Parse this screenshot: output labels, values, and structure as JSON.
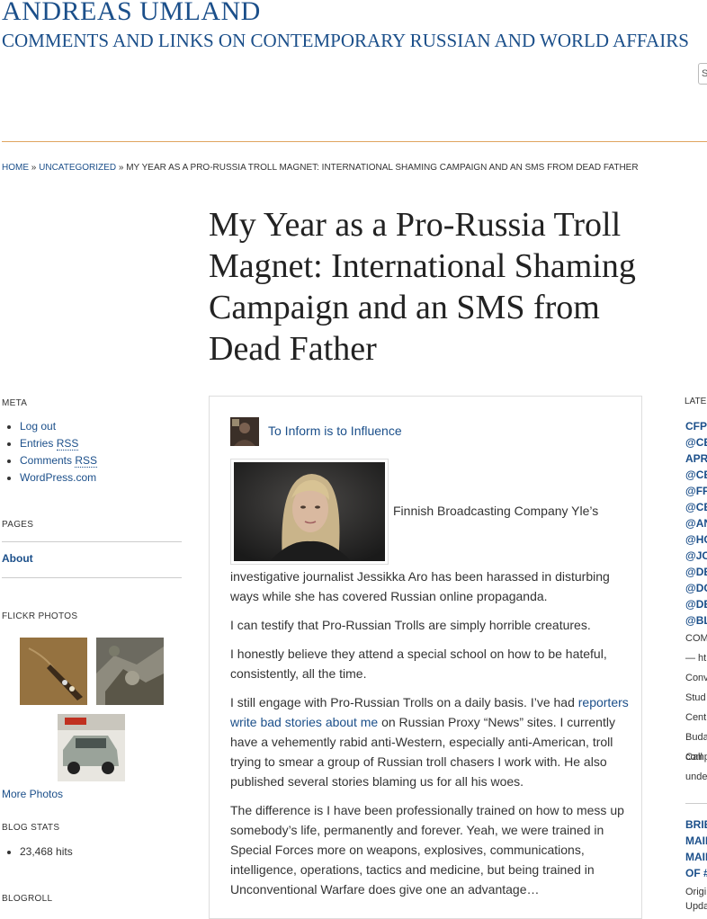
{
  "site": {
    "title": "ANDREAS UMLAND",
    "description": "COMMENTS AND LINKS ON CONTEMPORARY RUSSIAN AND WORLD AFFAIRS",
    "search_placeholder": "S"
  },
  "breadcrumb": {
    "home": "HOME",
    "sep1": " » ",
    "category": "UNCATEGORIZED",
    "sep2": " » ",
    "current": "MY YEAR AS A PRO-RUSSIA TROLL MAGNET: INTERNATIONAL SHAMING CAMPAIGN AND AN SMS FROM DEAD FATHER"
  },
  "post": {
    "title": "My Year as a Pro-Russia Troll Magnet: International Shaming Campaign and an SMS from Dead Father",
    "author": "To Inform is to Influence",
    "image_caption": "Finnish Broadcasting Company Yle’s",
    "p1": "investigative journalist Jessikka Aro has been harassed in disturbing ways while she has covered Russian online propaganda.",
    "p2": "I can testify that Pro-Russian Trolls are simply horrible creatures.",
    "p3": "I honestly believe they attend a special school on how to be hateful, consistently, all the time.",
    "p4_before": "I still engage with Pro-Russian Trolls on a daily basis.  I’ve had ",
    "p4_link": "reporters write bad stories about me",
    "p4_after": " on Russian Proxy “News” sites. I currently have a vehemently rabid anti-Western, especially anti-American, troll trying to smear a group of Russian troll chasers I work with.  He also published several stories blaming us for all his woes.",
    "p5": "The difference is I have been professionally trained on how to mess up somebody’s life, permanently and forever.  Yeah, we were trained in Special Forces more on weapons, explosives, communications, intelligence, operations, tactics and medicine, but being trained in Unconventional Warfare does give one an advantage…"
  },
  "sidebar": {
    "meta_title": "META",
    "meta_items": [
      "Log out",
      "Entries ",
      "Comments ",
      "WordPress.com"
    ],
    "rss": "RSS",
    "pages_title": "PAGES",
    "about": "About",
    "flickr_title": "FLICKR PHOTOS",
    "more_photos": "More Photos",
    "stats_title": "BLOG STATS",
    "hits": "23,468 hits",
    "blogroll_title": "BLOGROLL"
  },
  "right_sidebar": {
    "latest_title": "LATE",
    "links": [
      "CFP",
      "@CE",
      "APR",
      "@CE",
      "@FF",
      "@CE",
      "@AN",
      "@HC",
      "@JC",
      "@DE",
      "@DC",
      "@DE",
      "@BL"
    ],
    "text_lines": [
      "COM",
      "— ht",
      "Conv",
      "Stud",
      "Cent",
      "Buda",
      "Call",
      "comp",
      "unde"
    ],
    "links2": [
      "BRIE",
      "MAIL",
      "MAIL",
      "OF #"
    ],
    "text_lines2": [
      "Origi",
      "Upda"
    ]
  },
  "colors": {
    "link": "#1b4f8a",
    "header_rule": "#e0a560",
    "text": "#333333"
  }
}
